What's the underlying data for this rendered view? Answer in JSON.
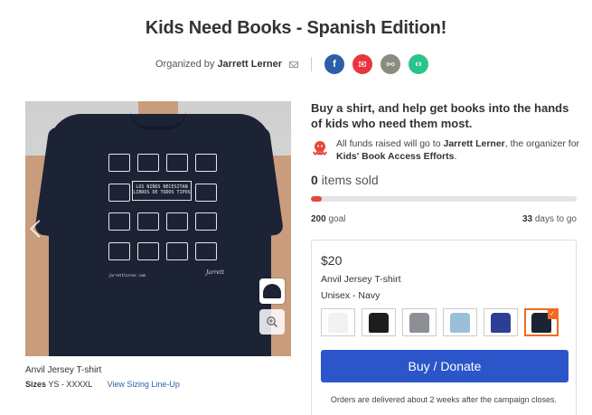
{
  "page": {
    "title": "Kids Need Books - Spanish Edition!"
  },
  "organizer": {
    "prefix": "Organized by",
    "name": "Jarrett Lerner"
  },
  "share": {
    "facebook_icon": "f",
    "email_icon": "✉",
    "link_icon": "⚯",
    "embed_icon": "‹›"
  },
  "product_image": {
    "shirt_banner": "LOS NIÑOS NECESITAN LIBROS DE TODOS TIPOS",
    "shirt_url": "jarrettlerner.com",
    "shirt_signature": "Jarrett"
  },
  "caption": {
    "product": "Anvil Jersey T-shirt",
    "sizes_label": "Sizes",
    "sizes_value": "YS - XXXXL",
    "sizing_link": "View Sizing Line-Up"
  },
  "campaign": {
    "headline": "Buy a shirt, and help get books into the hands of kids who need them most.",
    "funds_prefix": "All funds raised will go to",
    "funds_recipient": "Jarrett Lerner",
    "funds_middle": ", the organizer for",
    "funds_cause": "Kids' Book Access Efforts",
    "funds_suffix": ".",
    "sold_count": "0",
    "sold_label": "items sold",
    "progress_fraction": 0.04,
    "goal_value": "200",
    "goal_label": "goal",
    "days_value": "33",
    "days_label": "days to go",
    "accent_color": "#e8453c"
  },
  "buy_card": {
    "price": "$20",
    "product_name": "Anvil Jersey T-shirt",
    "variant": "Unisex - Navy",
    "swatches": [
      {
        "name": "white",
        "color": "#f2f2f2",
        "selected": false
      },
      {
        "name": "black",
        "color": "#1d1d1d",
        "selected": false
      },
      {
        "name": "heather-gray",
        "color": "#8c9096",
        "selected": false
      },
      {
        "name": "light-blue",
        "color": "#9bbfd9",
        "selected": false
      },
      {
        "name": "royal-blue",
        "color": "#2a3f95",
        "selected": false
      },
      {
        "name": "navy",
        "color": "#1c2335",
        "selected": true
      }
    ],
    "button_label": "Buy / Donate",
    "button_color": "#2b55c9",
    "delivery_note": "Orders are delivered about 2 weeks after the campaign closes."
  }
}
